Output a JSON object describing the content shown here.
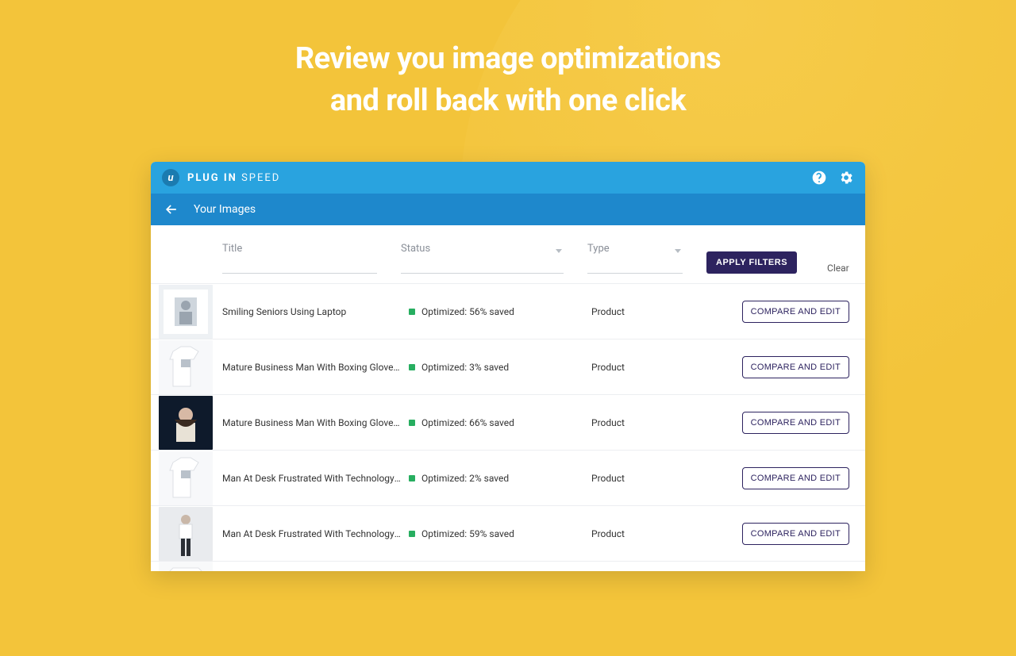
{
  "hero": {
    "line1": "Review you image optimizations",
    "line2": "and roll back with one click"
  },
  "topbar": {
    "logo_letter": "u",
    "brand_bold": "PLUG IN",
    "brand_light": "SPEED"
  },
  "subbar": {
    "title": "Your Images"
  },
  "filters": {
    "title_label": "Title",
    "status_label": "Status",
    "type_label": "Type",
    "apply_label": "APPLY FILTERS",
    "clear_label": "Clear"
  },
  "action_label": "COMPARE AND EDIT",
  "rows": [
    {
      "title": "Smiling Seniors Using Laptop",
      "status": "Optimized: 56% saved",
      "type": "Product",
      "thumb": "photo"
    },
    {
      "title": "Mature Business Man With Boxing Gloves Fighti…",
      "status": "Optimized: 3% saved",
      "type": "Product",
      "thumb": "tee-white"
    },
    {
      "title": "Mature Business Man With Boxing Gloves Fighti…",
      "status": "Optimized: 66% saved",
      "type": "Product",
      "thumb": "photo-dark"
    },
    {
      "title": "Man At Desk Frustrated With Technology t-shirt",
      "status": "Optimized: 2% saved",
      "type": "Product",
      "thumb": "tee-white"
    },
    {
      "title": "Man At Desk Frustrated With Technology t-shirt",
      "status": "Optimized: 59% saved",
      "type": "Product",
      "thumb": "photo-full"
    }
  ]
}
